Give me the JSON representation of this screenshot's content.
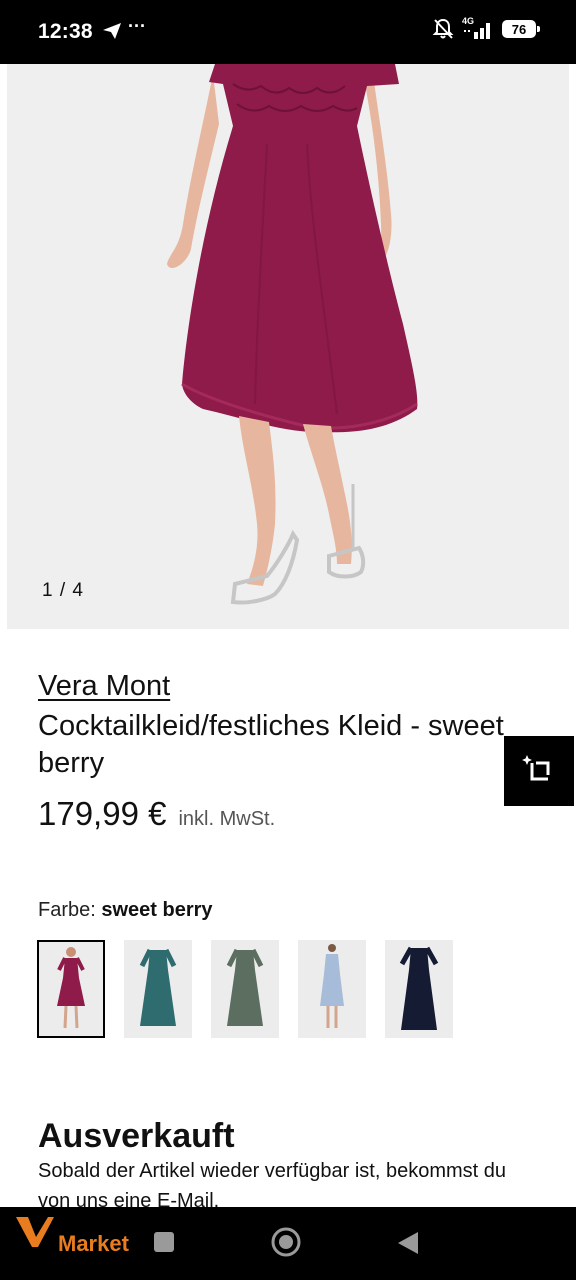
{
  "status_bar": {
    "time": "12:38",
    "more": "···",
    "network": "4G",
    "battery": "76"
  },
  "gallery": {
    "counter": "1 / 4"
  },
  "product": {
    "brand": "Vera Mont",
    "title": "Cocktailkleid/festliches Kleid - sweet berry",
    "price": "179,99 €",
    "vat_note": "inkl. MwSt."
  },
  "color": {
    "label": "Farbe:",
    "selected": "sweet berry",
    "swatches": [
      {
        "color": "#8e1b4a",
        "selected": true
      },
      {
        "color": "#2f6c70",
        "selected": false
      },
      {
        "color": "#5b6e5f",
        "selected": false
      },
      {
        "color": "#a7bcd8",
        "selected": false
      },
      {
        "color": "#141b33",
        "selected": false
      }
    ]
  },
  "availability": {
    "status": "Ausverkauft",
    "message": "Sobald der Artikel wieder verfügbar ist, bekommst du von uns eine E-Mail."
  },
  "bottom_bar": {
    "app_name": "Market"
  },
  "colors": {
    "dress": "#8e1b4a",
    "accent": "#e87c1e"
  }
}
